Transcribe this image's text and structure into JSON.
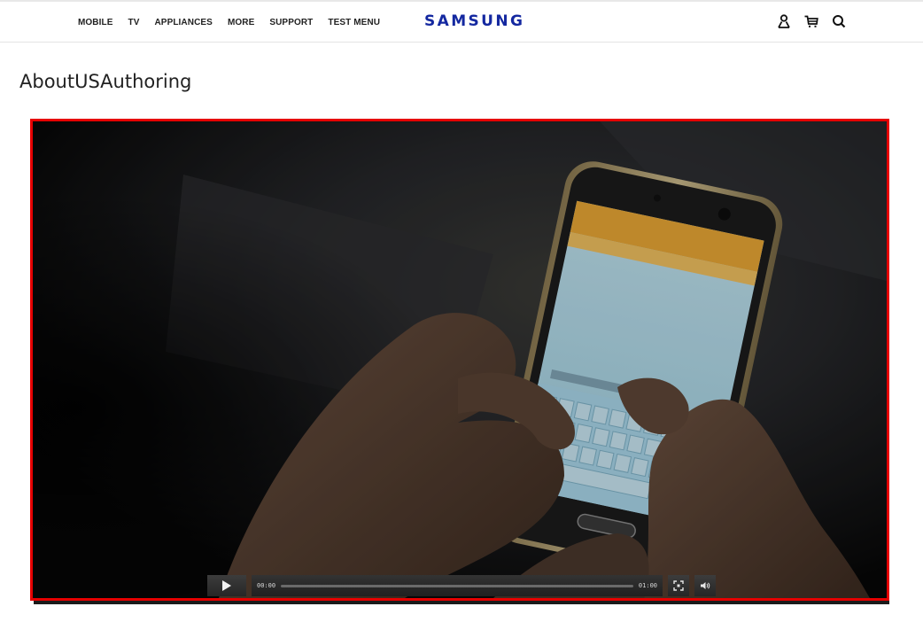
{
  "header": {
    "nav": [
      "MOBILE",
      "TV",
      "APPLIANCES",
      "MORE",
      "SUPPORT",
      "TEST MENU"
    ],
    "logo": "SAMSUNG",
    "icons": [
      "user-icon",
      "cart-icon",
      "search-icon"
    ]
  },
  "page": {
    "title": "AboutUSAuthoring"
  },
  "video": {
    "current_time": "00:00",
    "duration": "01:00",
    "progress": 0,
    "icons": [
      "play-icon",
      "fullscreen-icon",
      "volume-icon"
    ],
    "frame_color": "#e60000"
  },
  "colors": {
    "brand": "#1428a0",
    "accent_frame": "#e60000"
  }
}
